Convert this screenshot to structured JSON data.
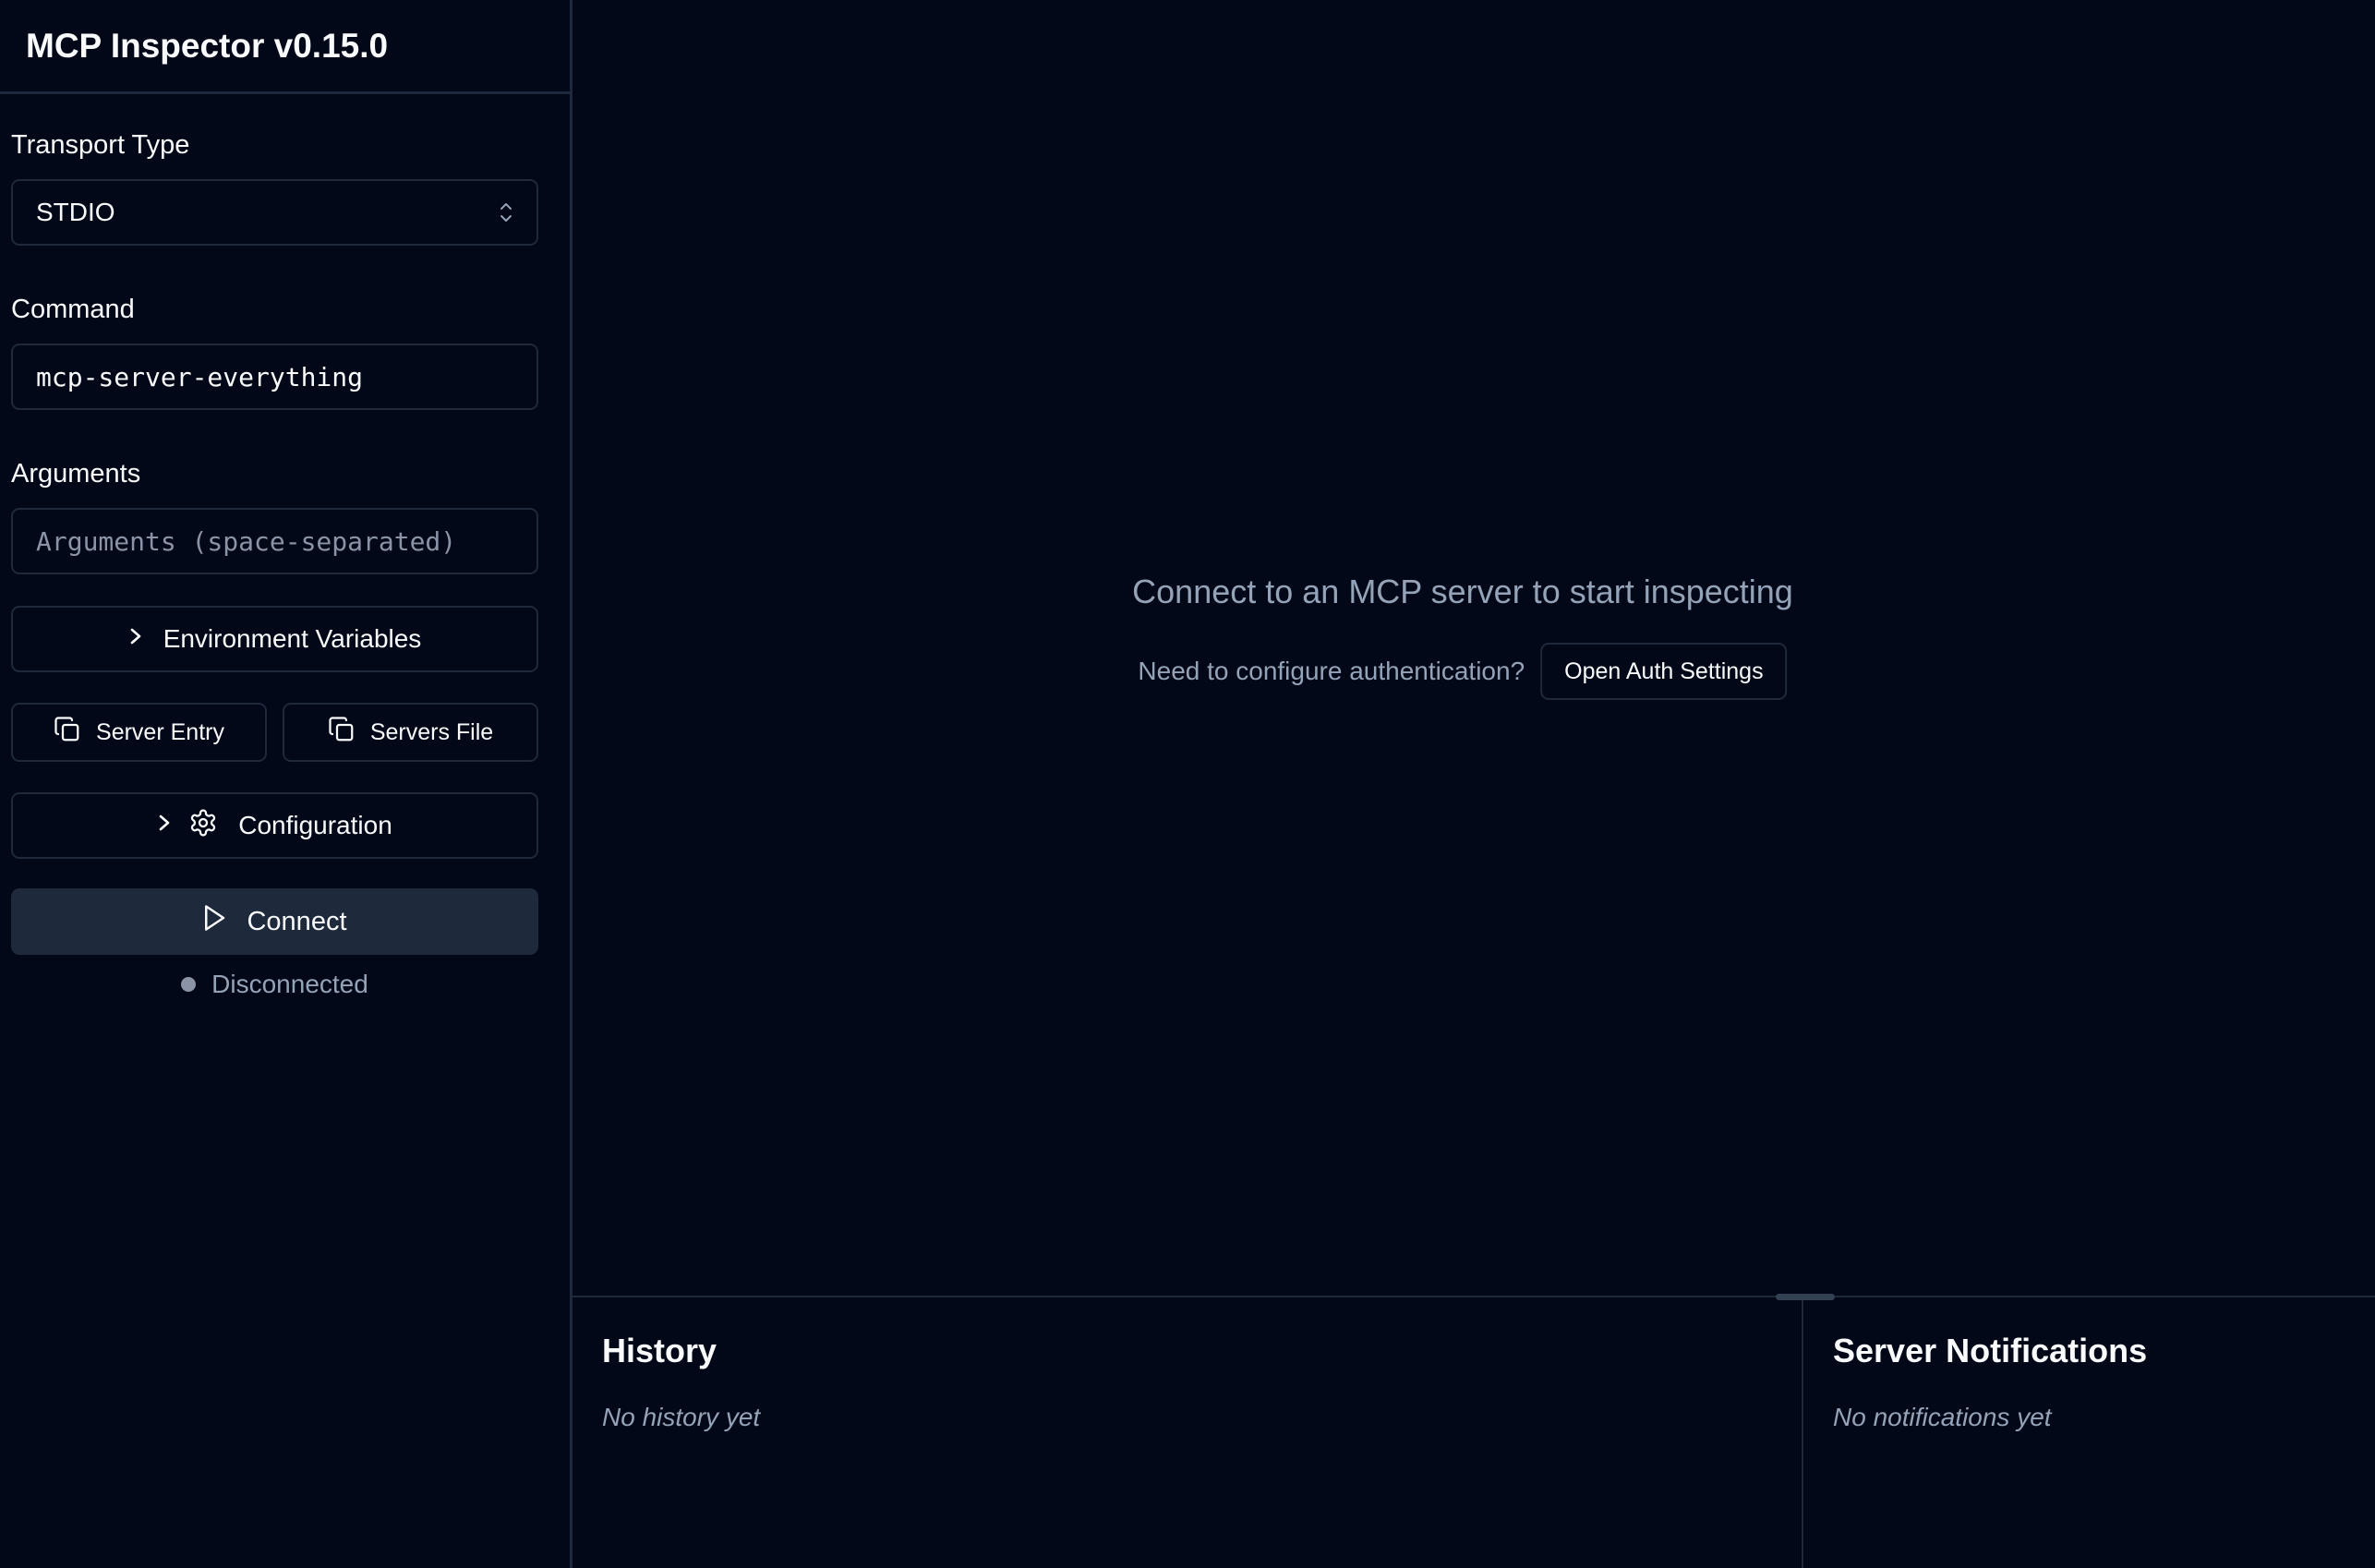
{
  "app": {
    "title": "MCP Inspector v0.15.0"
  },
  "sidebar": {
    "transport_label": "Transport Type",
    "transport_value": "STDIO",
    "command_label": "Command",
    "command_value": "mcp-server-everything",
    "arguments_label": "Arguments",
    "arguments_placeholder": "Arguments (space-separated)",
    "env_vars_label": "Environment Variables",
    "server_entry_label": "Server Entry",
    "servers_file_label": "Servers File",
    "configuration_label": "Configuration",
    "connect_label": "Connect",
    "status_text": "Disconnected"
  },
  "main": {
    "empty_title": "Connect to an MCP server to start inspecting",
    "auth_question": "Need to configure authentication?",
    "auth_button": "Open Auth Settings"
  },
  "history": {
    "title": "History",
    "empty": "No history yet"
  },
  "notifications": {
    "title": "Server Notifications",
    "empty": "No notifications yet"
  },
  "colors": {
    "background": "#020817",
    "border": "#1e293b",
    "text": "#f8fafc",
    "muted": "#94a3b8",
    "connect_bg": "#1e293b"
  }
}
